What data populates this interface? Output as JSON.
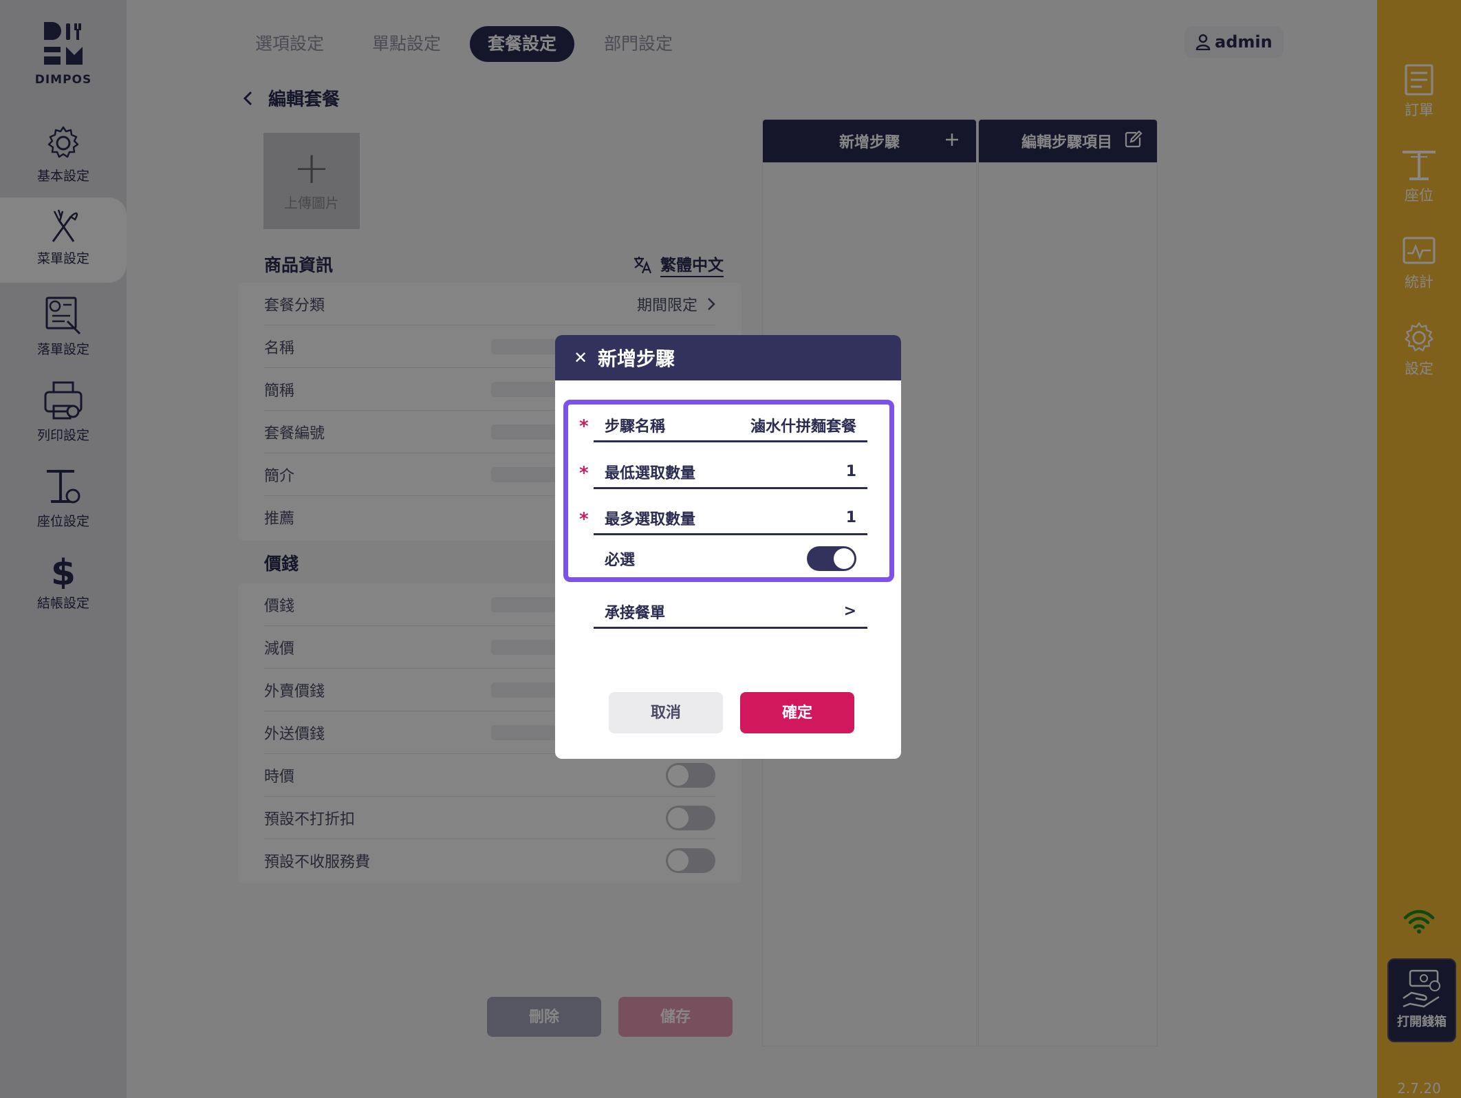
{
  "sidebar": {
    "logo_text": "DIMPOS",
    "items": [
      {
        "label": "基本設定",
        "icon": "gear-icon"
      },
      {
        "label": "菜單設定",
        "icon": "utensils-icon"
      },
      {
        "label": "落單設定",
        "icon": "order-ticket-icon"
      },
      {
        "label": "列印設定",
        "icon": "printer-icon"
      },
      {
        "label": "座位設定",
        "icon": "table-settings-icon"
      },
      {
        "label": "結帳設定",
        "icon": "dollar-icon"
      }
    ]
  },
  "tabs": [
    {
      "label": "選項設定"
    },
    {
      "label": "單點設定"
    },
    {
      "label": "套餐設定"
    },
    {
      "label": "部門設定"
    }
  ],
  "user": {
    "name": "admin"
  },
  "page": {
    "title": "編輯套餐",
    "upload_label": "上傳圖片",
    "product_info_title": "商品資訊",
    "language": "繁體中文",
    "product_rows": [
      {
        "label": "套餐分類",
        "value": "期間限定"
      },
      {
        "label": "名稱"
      },
      {
        "label": "簡稱"
      },
      {
        "label": "套餐編號"
      },
      {
        "label": "簡介"
      },
      {
        "label": "推薦"
      }
    ],
    "price_title": "價錢",
    "price_rows": [
      {
        "label": "價錢"
      },
      {
        "label": "減價"
      },
      {
        "label": "外賣價錢"
      },
      {
        "label": "外送價錢"
      },
      {
        "label": "時價"
      },
      {
        "label": "預設不打折扣"
      },
      {
        "label": "預設不收服務費"
      }
    ],
    "delete_label": "刪除",
    "save_label": "儲存"
  },
  "steps": {
    "add_step_label": "新增步驟",
    "edit_items_label": "編輯步驟項目"
  },
  "rightbar": {
    "items": [
      {
        "label": "訂單",
        "icon": "order-list-icon"
      },
      {
        "label": "座位",
        "icon": "table-icon"
      },
      {
        "label": "統計",
        "icon": "stats-icon"
      },
      {
        "label": "設定",
        "icon": "gear-icon"
      }
    ],
    "wifi_icon": "wifi-icon",
    "cash_drawer_label": "打開錢箱",
    "version": "2.7.20"
  },
  "modal": {
    "title": "新增步驟",
    "fields": {
      "step_name_label": "步驟名稱",
      "step_name_value": "滷水什拼麵套餐",
      "min_select_label": "最低選取數量",
      "min_select_value": "1",
      "max_select_label": "最多選取數量",
      "max_select_value": "1",
      "required_label": "必選",
      "required_on": true,
      "carry_menu_label": "承接餐單",
      "carry_menu_chevron": ">"
    },
    "cancel_label": "取消",
    "confirm_label": "確定",
    "required_mark": "*"
  },
  "colors": {
    "navy": "#2b2b52",
    "accent_pink": "#d1185c",
    "highlight_purple": "#7b52ee",
    "rightbar_yellow": "#f1b733"
  }
}
